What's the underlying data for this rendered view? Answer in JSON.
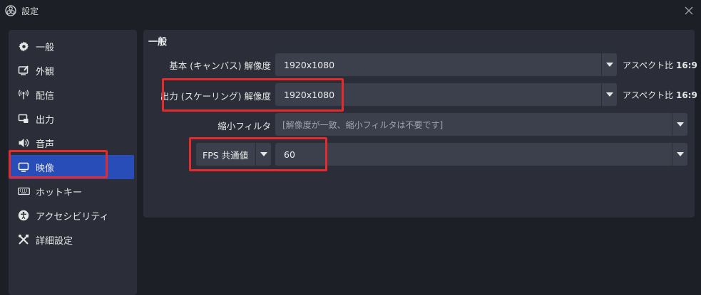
{
  "window": {
    "title": "設定"
  },
  "sidebar": {
    "items": [
      {
        "label": "一般",
        "icon": "gear-icon"
      },
      {
        "label": "外観",
        "icon": "appearance-icon"
      },
      {
        "label": "配信",
        "icon": "broadcast-icon"
      },
      {
        "label": "出力",
        "icon": "output-icon"
      },
      {
        "label": "音声",
        "icon": "speaker-icon"
      },
      {
        "label": "映像",
        "icon": "monitor-icon"
      },
      {
        "label": "ホットキー",
        "icon": "keyboard-icon"
      },
      {
        "label": "アクセシビリティ",
        "icon": "accessibility-icon"
      },
      {
        "label": "詳細設定",
        "icon": "tools-icon"
      }
    ],
    "active_index": 5
  },
  "panel": {
    "title": "一般",
    "base_resolution": {
      "label": "基本 (キャンバス) 解像度",
      "value": "1920x1080",
      "aspect_prefix": "アスペクト比",
      "aspect_value": "16:9"
    },
    "output_resolution": {
      "label": "出力 (スケーリング) 解像度",
      "value": "1920x1080",
      "aspect_prefix": "アスペクト比",
      "aspect_value": "16:9"
    },
    "downscale_filter": {
      "label": "縮小フィルタ",
      "placeholder": "[解像度が一致、縮小フィルタは不要です]"
    },
    "fps": {
      "type_value": "FPS 共通値",
      "value": "60"
    }
  },
  "colors": {
    "accent": "#284cb8",
    "highlight": "#e52b2b",
    "background": "#1d1f26",
    "panel": "#2b2e38",
    "control": "#3c404d"
  }
}
